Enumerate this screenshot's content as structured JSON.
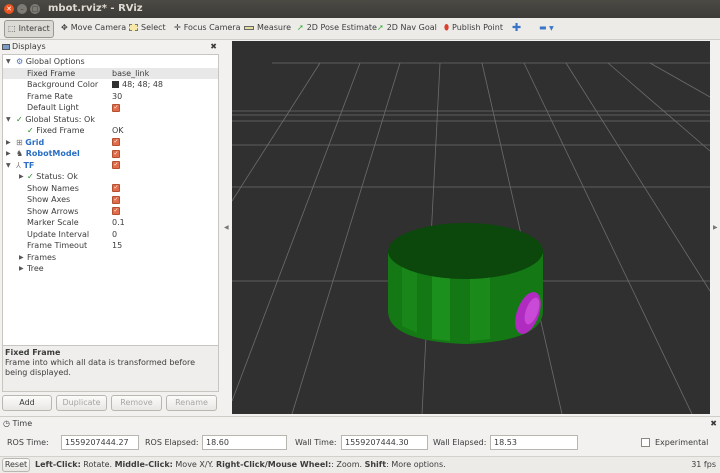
{
  "window": {
    "title": "mbot.rviz* - RViz"
  },
  "toolbar": {
    "tools": [
      {
        "label": "Interact",
        "icon": "cursor-icon"
      },
      {
        "label": "Move Camera",
        "icon": "move-camera-icon"
      },
      {
        "label": "Select",
        "icon": "select-icon"
      },
      {
        "label": "Focus Camera",
        "icon": "focus-camera-icon"
      },
      {
        "label": "Measure",
        "icon": "ruler-icon"
      },
      {
        "label": "2D Pose Estimate",
        "icon": "pose-arrow-icon"
      },
      {
        "label": "2D Nav Goal",
        "icon": "nav-goal-arrow-icon"
      },
      {
        "label": "Publish Point",
        "icon": "map-pin-icon"
      }
    ]
  },
  "displays": {
    "title": "Displays",
    "rows": [
      {
        "label": "Global Options",
        "value": ""
      },
      {
        "label": "Fixed Frame",
        "value": "base_link"
      },
      {
        "label": "Background Color",
        "value": "48; 48; 48"
      },
      {
        "label": "Frame Rate",
        "value": "30"
      },
      {
        "label": "Default Light",
        "value": ""
      },
      {
        "label": "Global Status: Ok",
        "value": ""
      },
      {
        "label": "Fixed Frame",
        "value": "OK"
      },
      {
        "label": "Grid",
        "value": ""
      },
      {
        "label": "RobotModel",
        "value": ""
      },
      {
        "label": "TF",
        "value": ""
      },
      {
        "label": "Status: Ok",
        "value": ""
      },
      {
        "label": "Show Names",
        "value": ""
      },
      {
        "label": "Show Axes",
        "value": ""
      },
      {
        "label": "Show Arrows",
        "value": ""
      },
      {
        "label": "Marker Scale",
        "value": "0.1"
      },
      {
        "label": "Update Interval",
        "value": "0"
      },
      {
        "label": "Frame Timeout",
        "value": "15"
      },
      {
        "label": "Frames",
        "value": ""
      },
      {
        "label": "Tree",
        "value": ""
      }
    ],
    "description_title": "Fixed Frame",
    "description_text": "Frame into which all data is transformed before being displayed.",
    "buttons": {
      "add": "Add",
      "duplicate": "Duplicate",
      "remove": "Remove",
      "rename": "Rename"
    }
  },
  "time_panel": {
    "title": "Time",
    "ros_time_label": "ROS Time:",
    "ros_time": "1559207444.27",
    "ros_elapsed_label": "ROS Elapsed:",
    "ros_elapsed": "18.60",
    "wall_time_label": "Wall Time:",
    "wall_time": "1559207444.30",
    "wall_elapsed_label": "Wall Elapsed:",
    "wall_elapsed": "18.53",
    "experimental_label": "Experimental"
  },
  "statusbar": {
    "reset_label": "Reset",
    "hint_b1": "Left-Click:",
    "hint_t1": " Rotate. ",
    "hint_b2": "Middle-Click:",
    "hint_t2": " Move X/Y. ",
    "hint_b3": "Right-Click/Mouse Wheel:",
    "hint_t3": ": Zoom. ",
    "hint_b4": "Shift",
    "hint_t4": ": More options.",
    "fps": "31 fps"
  },
  "colors": {
    "viewport_bg": "#303030",
    "robot_body": "#1e8a1e",
    "wheel": "#b02cc0"
  }
}
